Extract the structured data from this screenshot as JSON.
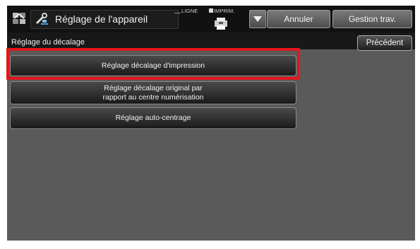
{
  "header": {
    "title": "Réglage de l'appareil",
    "ligne_label": "LIGNE",
    "imprim_label": "IMPRIM.",
    "cancel_label": "Annuler",
    "job_status_label": "Gestion trav."
  },
  "subheader": {
    "title": "Réglage du décalage",
    "back_label": "Précédent"
  },
  "menu": {
    "items": [
      {
        "line1": "Réglage décalage d'impression",
        "line2": ""
      },
      {
        "line1": "Réglage décalage original par",
        "line2": "rapport au centre numérisation"
      },
      {
        "line1": "Réglage auto-centrage",
        "line2": ""
      }
    ]
  },
  "colors": {
    "highlight": "#e4161c",
    "screen_bg": "#5a5a5a",
    "bar_bg": "#111111"
  },
  "icons": [
    "home-icon",
    "tools-icon",
    "printer-icon",
    "dropdown-arrow-icon"
  ]
}
